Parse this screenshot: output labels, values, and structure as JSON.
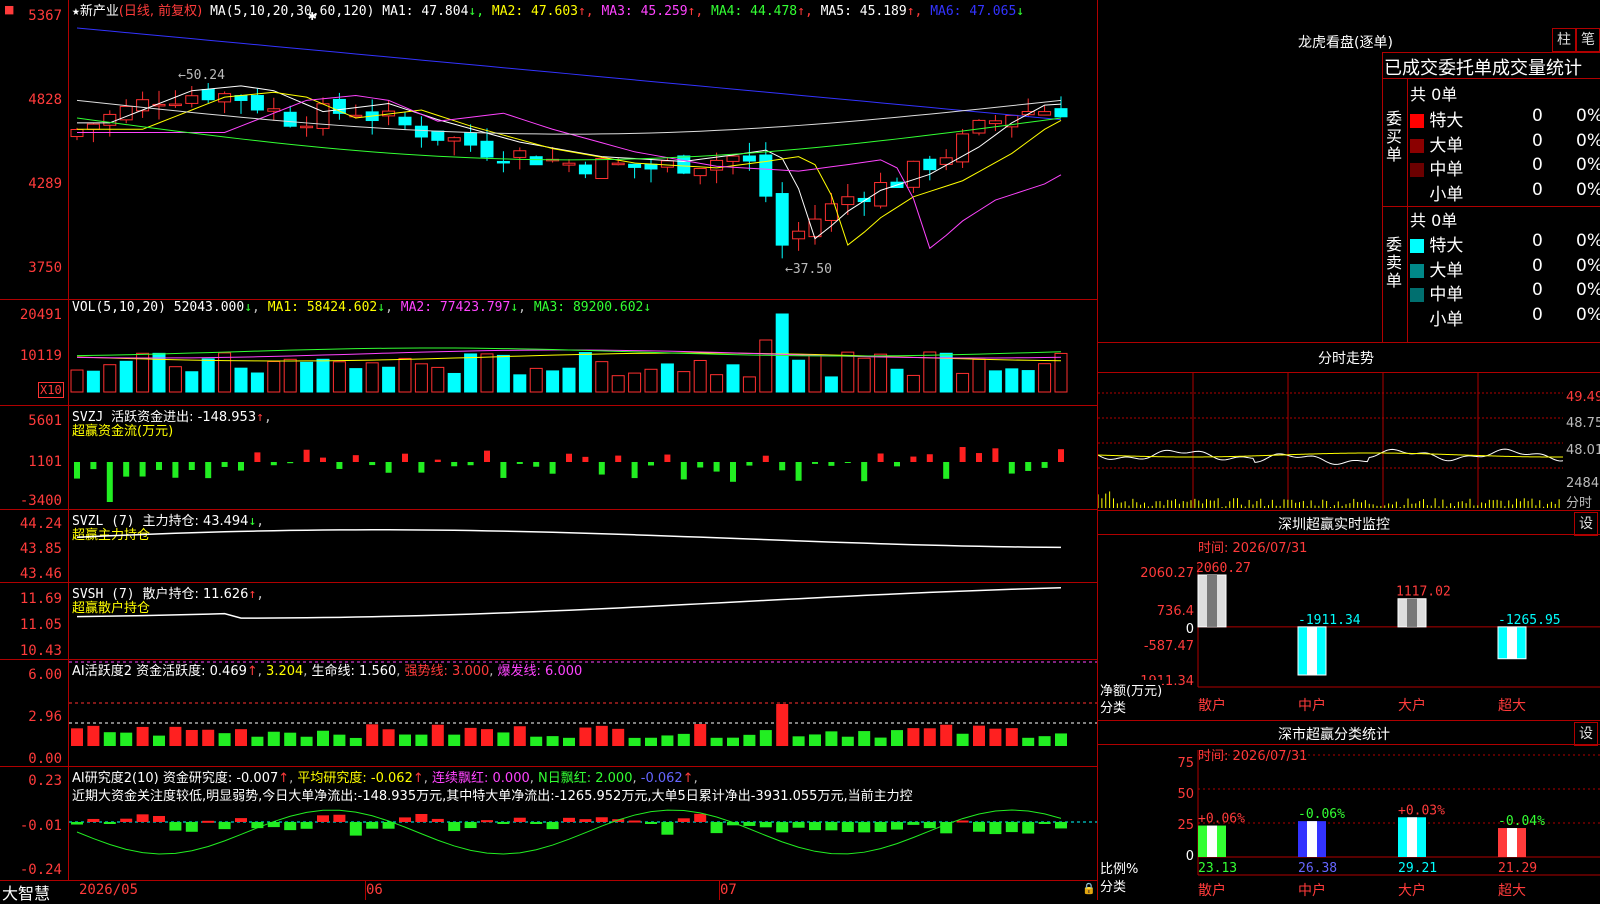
{
  "title": {
    "star": "★",
    "name": "新产业",
    "mode": "(日线, 前复权)",
    "ma_label": "MA(5,10,20,30,60,120)"
  },
  "ma": [
    {
      "label": "MA1: 47.804",
      "arrow": "↓",
      "color": "#ffffff"
    },
    {
      "label": "MA2: 47.603",
      "arrow": "↑",
      "color": "#ffff00"
    },
    {
      "label": "MA3: 45.259",
      "arrow": "↑",
      "color": "#ff44ff"
    },
    {
      "label": "MA4: 44.478",
      "arrow": "↑",
      "color": "#33ff33"
    },
    {
      "label": "MA5: 45.189",
      "arrow": "↑",
      "color": "#ffffff"
    },
    {
      "label": "MA6: 47.065",
      "arrow": "↓",
      "color": "#3333ff"
    }
  ],
  "main_axis": [
    "5367",
    "4828",
    "4289",
    "3750"
  ],
  "annotations": {
    "high": "←50.24",
    "low": "←37.50"
  },
  "vol": {
    "title": "VOL(5,10,20)",
    "value": "52043.000",
    "ma1": "MA1: 58424.602",
    "ma2": "MA2: 77423.797",
    "ma3": "MA3: 89200.602",
    "axis": [
      "20491",
      "10119"
    ],
    "unit": "X10"
  },
  "svzj": {
    "title": "SVZJ",
    "desc": "活跃资金进出: -148.953",
    "sub": "超赢资金流(万元)",
    "axis": [
      "5601",
      "1101",
      "-3400"
    ]
  },
  "svzl": {
    "title": "SVZL (7)",
    "desc": "主力持仓: 43.494",
    "sub": "超赢主力持仓",
    "axis": [
      "44.24",
      "43.85",
      "43.46"
    ]
  },
  "svsh": {
    "title": "SVSH (7)",
    "desc": "散户持仓: 11.626",
    "sub": "超赢散户持仓",
    "axis": [
      "11.69",
      "11.05",
      "10.43"
    ]
  },
  "ai1": {
    "title": "AI活跃度2",
    "a": "资金活跃度: 0.469",
    "b": "3.204",
    "c": "生命线: 1.560",
    "d": "强势线: 3.000",
    "e": "爆发线: 6.000",
    "axis": [
      "6.00",
      "2.96",
      "0.00"
    ]
  },
  "ai2": {
    "title": "AI研究度2(10)",
    "a": "资金研究度: -0.007",
    "b": "平均研究度: -0.062",
    "c": "连续飘红: 0.000",
    "d": "N日飘红: 2.000",
    "e": "-0.062",
    "axis": [
      "0.23",
      "-0.01",
      "-0.24"
    ],
    "comment": "近期大资金关注度较低,明显弱势,今日大单净流出:-148.935万元,其中特大单净流出:-1265.952万元,大单5日累计净出-3931.055万元,当前主力控"
  },
  "x_axis": {
    "brand": "大智慧",
    "labels": [
      "2026/05",
      "06",
      "07"
    ]
  },
  "right": {
    "lhb_title": "龙虎看盘(逐单)",
    "btn1": "柱",
    "btn2": "笔",
    "order_header": "已成交委托单成交量统计",
    "buy": {
      "label": "委买单",
      "total": "共 0单",
      "rows": [
        {
          "name": "特大",
          "count": "0",
          "pct": "0%",
          "color": "#ff0000"
        },
        {
          "name": "大单",
          "count": "0",
          "pct": "0%",
          "color": "#8b0000"
        },
        {
          "name": "中单",
          "count": "0",
          "pct": "0%",
          "color": "#6b0000"
        },
        {
          "name": "小单",
          "count": "0",
          "pct": "0%",
          "color": "#000000"
        }
      ]
    },
    "sell": {
      "label": "委卖单",
      "total": "共 0单",
      "rows": [
        {
          "name": "特大",
          "count": "0",
          "pct": "0%",
          "color": "#00ffff"
        },
        {
          "name": "大单",
          "count": "0",
          "pct": "0%",
          "color": "#008888"
        },
        {
          "name": "中单",
          "count": "0",
          "pct": "0%",
          "color": "#006f6f"
        },
        {
          "name": "小单",
          "count": "0",
          "pct": "0%",
          "color": "#000000"
        }
      ]
    },
    "fenshi": {
      "title": "分时走势",
      "axis": [
        "49.49",
        "48.75",
        "48.01",
        "2484",
        "分时"
      ]
    },
    "sz_monitor": {
      "title": "深圳超赢实时监控",
      "btn": "设",
      "time": "时间: 2026/07/31",
      "axis": [
        "2060.27",
        "736.4",
        "0",
        "-587.47",
        "-1911.34"
      ],
      "unit": "净额(万元)",
      "cls": "分类",
      "bars": [
        {
          "name": "散户",
          "value": "2060.27",
          "num": 2060.27
        },
        {
          "name": "中户",
          "value": "-1911.34",
          "num": -1911.34
        },
        {
          "name": "大户",
          "value": "1117.02",
          "num": 1117.02
        },
        {
          "name": "超大",
          "value": "-1265.95",
          "num": -1265.95
        }
      ]
    },
    "sz_stats": {
      "title": "深市超赢分类统计",
      "btn": "设",
      "time": "时间: 2026/07/31",
      "axis": [
        "75",
        "50",
        "25",
        "0"
      ],
      "unit": "比例%",
      "cls": "分类",
      "bars": [
        {
          "name": "散户",
          "pct": "+0.06%",
          "value": "23.13",
          "num": 23.13,
          "color": "#33ff33"
        },
        {
          "name": "中户",
          "pct": "-0.06%",
          "value": "26.38",
          "num": 26.38,
          "color": "#3333ff"
        },
        {
          "name": "大户",
          "pct": "+0.03%",
          "value": "29.21",
          "num": 29.21,
          "color": "#00ffff"
        },
        {
          "name": "超大",
          "pct": "-0.04%",
          "value": "21.29",
          "num": 21.29,
          "color": "#ff3b3b"
        }
      ]
    }
  }
}
